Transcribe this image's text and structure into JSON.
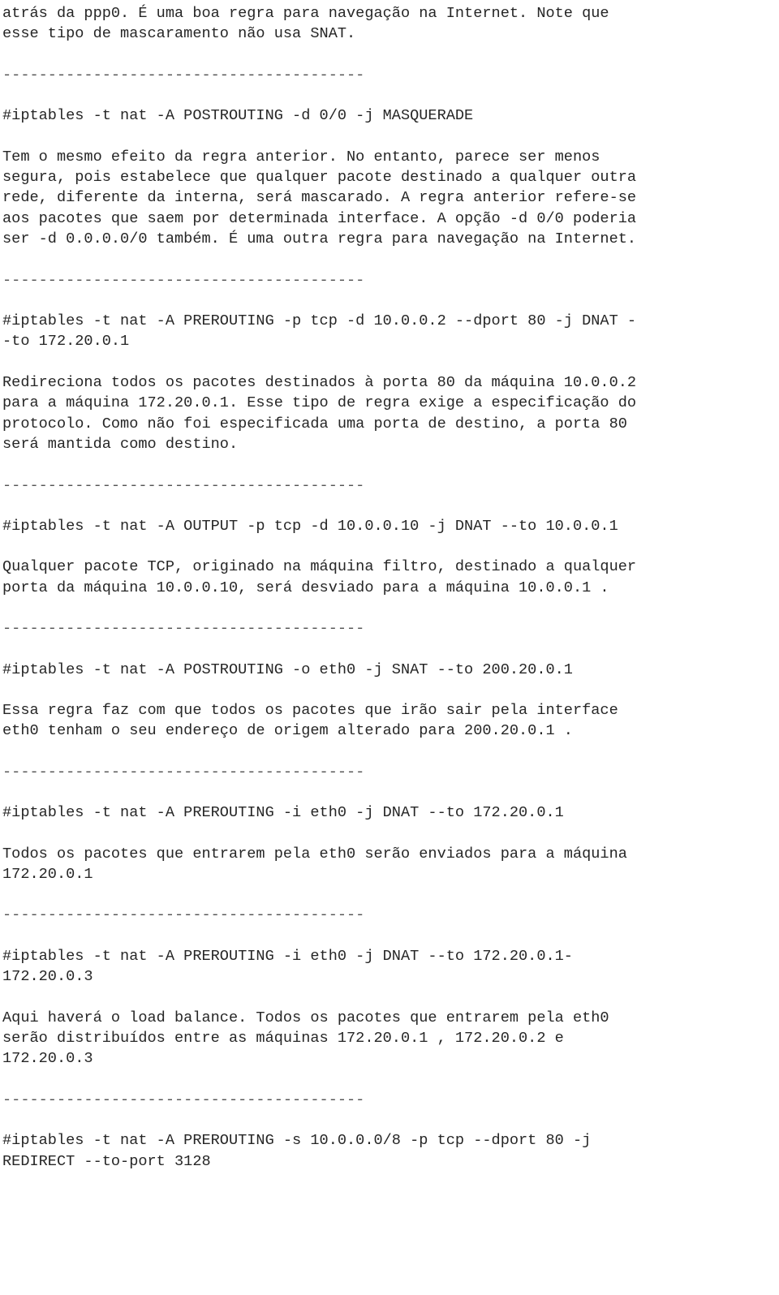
{
  "page": {
    "language": "pt-BR",
    "topic": "iptables NAT rules reference",
    "text_color": "#262626",
    "background_color": "#ffffff",
    "divider_color": "#555555",
    "divider": "----------------------------------------"
  },
  "content": {
    "intro_paragraph": "atrás da ppp0. É uma boa regra para navegação na Internet. Note que\nesse tipo de mascaramento não usa SNAT.",
    "sections": [
      {
        "command": "#iptables -t nat -A POSTROUTING -d 0/0 -j MASQUERADE",
        "description": "Tem o mesmo efeito da regra anterior. No entanto, parece ser menos\nsegura, pois estabelece que qualquer pacote destinado a qualquer outra\nrede, diferente da interna, será mascarado. A regra anterior refere-se\naos pacotes que saem por determinada interface. A opção -d 0/0 poderia\nser -d 0.0.0.0/0 também. É uma outra regra para navegação na Internet."
      },
      {
        "command": "#iptables -t nat -A PREROUTING -p tcp -d 10.0.0.2 --dport 80 -j DNAT -\n-to 172.20.0.1",
        "description": "Redireciona todos os pacotes destinados à porta 80 da máquina 10.0.0.2\npara a máquina 172.20.0.1. Esse tipo de regra exige a especificação do\nprotocolo. Como não foi especificada uma porta de destino, a porta 80\nserá mantida como destino."
      },
      {
        "command": "#iptables -t nat -A OUTPUT -p tcp -d 10.0.0.10 -j DNAT --to 10.0.0.1",
        "description": "Qualquer pacote TCP, originado na máquina filtro, destinado a qualquer\nporta da máquina 10.0.0.10, será desviado para a máquina 10.0.0.1 ."
      },
      {
        "command": "#iptables -t nat -A POSTROUTING -o eth0 -j SNAT --to 200.20.0.1",
        "description": "Essa regra faz com que todos os pacotes que irão sair pela interface\neth0 tenham o seu endereço de origem alterado para 200.20.0.1 ."
      },
      {
        "command": "#iptables -t nat -A PREROUTING -i eth0 -j DNAT --to 172.20.0.1",
        "description": "Todos os pacotes que entrarem pela eth0 serão enviados para a máquina\n172.20.0.1"
      },
      {
        "command": "#iptables -t nat -A PREROUTING -i eth0 -j DNAT --to 172.20.0.1-\n172.20.0.3",
        "description": "Aqui haverá o load balance. Todos os pacotes que entrarem pela eth0\nserão distribuídos entre as máquinas 172.20.0.1 , 172.20.0.2 e\n172.20.0.3"
      },
      {
        "command": "#iptables -t nat -A PREROUTING -s 10.0.0.0/8 -p tcp --dport 80 -j\nREDIRECT --to-port 3128",
        "description": ""
      }
    ]
  }
}
